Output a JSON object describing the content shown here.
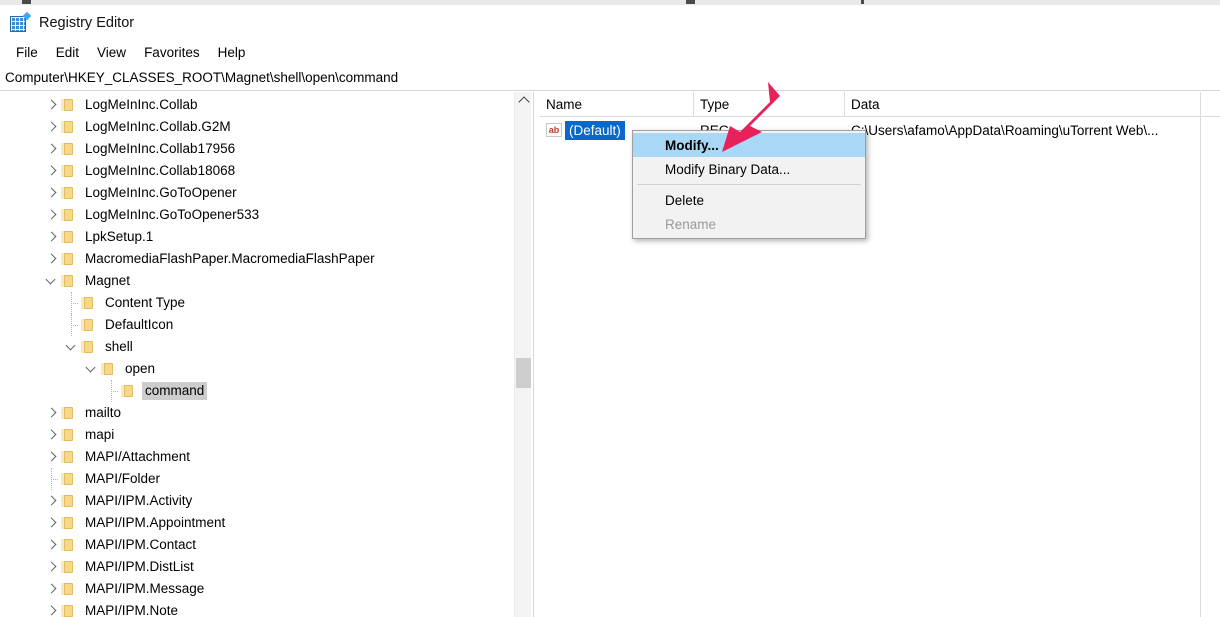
{
  "window": {
    "title": "Registry Editor",
    "icon": "registry-editor-icon"
  },
  "menubar": {
    "items": [
      {
        "label": "File"
      },
      {
        "label": "Edit"
      },
      {
        "label": "View"
      },
      {
        "label": "Favorites"
      },
      {
        "label": "Help"
      }
    ]
  },
  "address": {
    "path": "Computer\\HKEY_CLASSES_ROOT\\Magnet\\shell\\open\\command"
  },
  "tree": {
    "nodes": [
      {
        "label": "LogMeInInc.Collab",
        "depth": 0,
        "state": "collapsed",
        "selected": false
      },
      {
        "label": "LogMeInInc.Collab.G2M",
        "depth": 0,
        "state": "collapsed",
        "selected": false
      },
      {
        "label": "LogMeInInc.Collab17956",
        "depth": 0,
        "state": "collapsed",
        "selected": false
      },
      {
        "label": "LogMeInInc.Collab18068",
        "depth": 0,
        "state": "collapsed",
        "selected": false
      },
      {
        "label": "LogMeInInc.GoToOpener",
        "depth": 0,
        "state": "collapsed",
        "selected": false
      },
      {
        "label": "LogMeInInc.GoToOpener533",
        "depth": 0,
        "state": "collapsed",
        "selected": false
      },
      {
        "label": "LpkSetup.1",
        "depth": 0,
        "state": "collapsed",
        "selected": false
      },
      {
        "label": "MacromediaFlashPaper.MacromediaFlashPaper",
        "depth": 0,
        "state": "collapsed",
        "selected": false
      },
      {
        "label": "Magnet",
        "depth": 0,
        "state": "expanded",
        "selected": false
      },
      {
        "label": "Content Type",
        "depth": 1,
        "state": "leaf",
        "selected": false
      },
      {
        "label": "DefaultIcon",
        "depth": 1,
        "state": "leaf",
        "selected": false
      },
      {
        "label": "shell",
        "depth": 1,
        "state": "expanded",
        "selected": false
      },
      {
        "label": "open",
        "depth": 2,
        "state": "expanded",
        "selected": false
      },
      {
        "label": "command",
        "depth": 3,
        "state": "leaf",
        "selected": true
      },
      {
        "label": "mailto",
        "depth": 0,
        "state": "collapsed",
        "selected": false
      },
      {
        "label": "mapi",
        "depth": 0,
        "state": "collapsed",
        "selected": false
      },
      {
        "label": "MAPI/Attachment",
        "depth": 0,
        "state": "collapsed",
        "selected": false
      },
      {
        "label": "MAPI/Folder",
        "depth": 0,
        "state": "leaf",
        "selected": false
      },
      {
        "label": "MAPI/IPM.Activity",
        "depth": 0,
        "state": "collapsed",
        "selected": false
      },
      {
        "label": "MAPI/IPM.Appointment",
        "depth": 0,
        "state": "collapsed",
        "selected": false
      },
      {
        "label": "MAPI/IPM.Contact",
        "depth": 0,
        "state": "collapsed",
        "selected": false
      },
      {
        "label": "MAPI/IPM.DistList",
        "depth": 0,
        "state": "collapsed",
        "selected": false
      },
      {
        "label": "MAPI/IPM.Message",
        "depth": 0,
        "state": "collapsed",
        "selected": false
      },
      {
        "label": "MAPI/IPM.Note",
        "depth": 0,
        "state": "collapsed",
        "selected": false
      }
    ]
  },
  "list": {
    "columns": [
      {
        "label": "Name"
      },
      {
        "label": "Type"
      },
      {
        "label": "Data"
      }
    ],
    "rows": [
      {
        "icon": "string-value-icon",
        "icon_text": "ab",
        "name": "(Default)",
        "type": "REG_",
        "data": "C:\\Users\\afamo\\AppData\\Roaming\\uTorrent Web\\...",
        "selected": true
      }
    ]
  },
  "context_menu": {
    "items": [
      {
        "label": "Modify...",
        "highlighted": true,
        "disabled": false,
        "separator_after": false
      },
      {
        "label": "Modify Binary Data...",
        "highlighted": false,
        "disabled": false,
        "separator_after": true
      },
      {
        "label": "Delete",
        "highlighted": false,
        "disabled": false,
        "separator_after": false
      },
      {
        "label": "Rename",
        "highlighted": false,
        "disabled": true,
        "separator_after": false
      }
    ]
  },
  "annotation": {
    "arrow": "red-arrow-pointer",
    "color": "#E8215B"
  },
  "scrollbar": {
    "up_arrow": "scroll-up-icon"
  }
}
